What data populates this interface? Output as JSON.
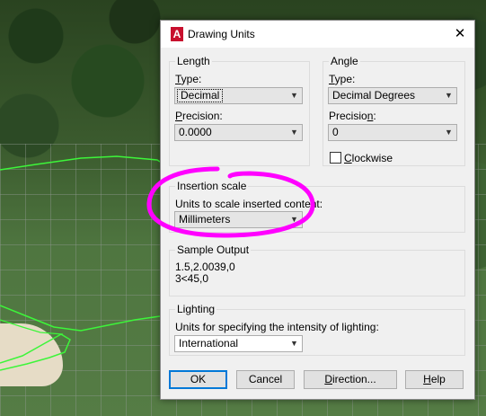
{
  "dialog": {
    "title": "Drawing Units",
    "close_glyph": "✕",
    "app_letter": "A"
  },
  "length": {
    "legend": "Length",
    "type_label": "Type:",
    "type_value": "Decimal",
    "precision_label": "Precision:",
    "precision_value": "0.0000"
  },
  "angle": {
    "legend": "Angle",
    "type_label": "Type:",
    "type_value": "Decimal Degrees",
    "precision_label": "Precision:",
    "precision_value": "0",
    "clockwise_label": "Clockwise",
    "clockwise_checked": false
  },
  "insertion": {
    "legend": "Insertion scale",
    "description": "Units to scale inserted content:",
    "value": "Millimeters"
  },
  "sample": {
    "legend": "Sample Output",
    "line1": "1.5,2.0039,0",
    "line2": "3<45,0"
  },
  "lighting": {
    "legend": "Lighting",
    "description": "Units for specifying the intensity of lighting:",
    "value": "International"
  },
  "buttons": {
    "ok": "OK",
    "cancel": "Cancel",
    "direction": "Direction...",
    "help": "Help"
  },
  "colors": {
    "annotation": "#ff00ff",
    "polyline": "#3df53a",
    "accent": "#0078d7"
  }
}
